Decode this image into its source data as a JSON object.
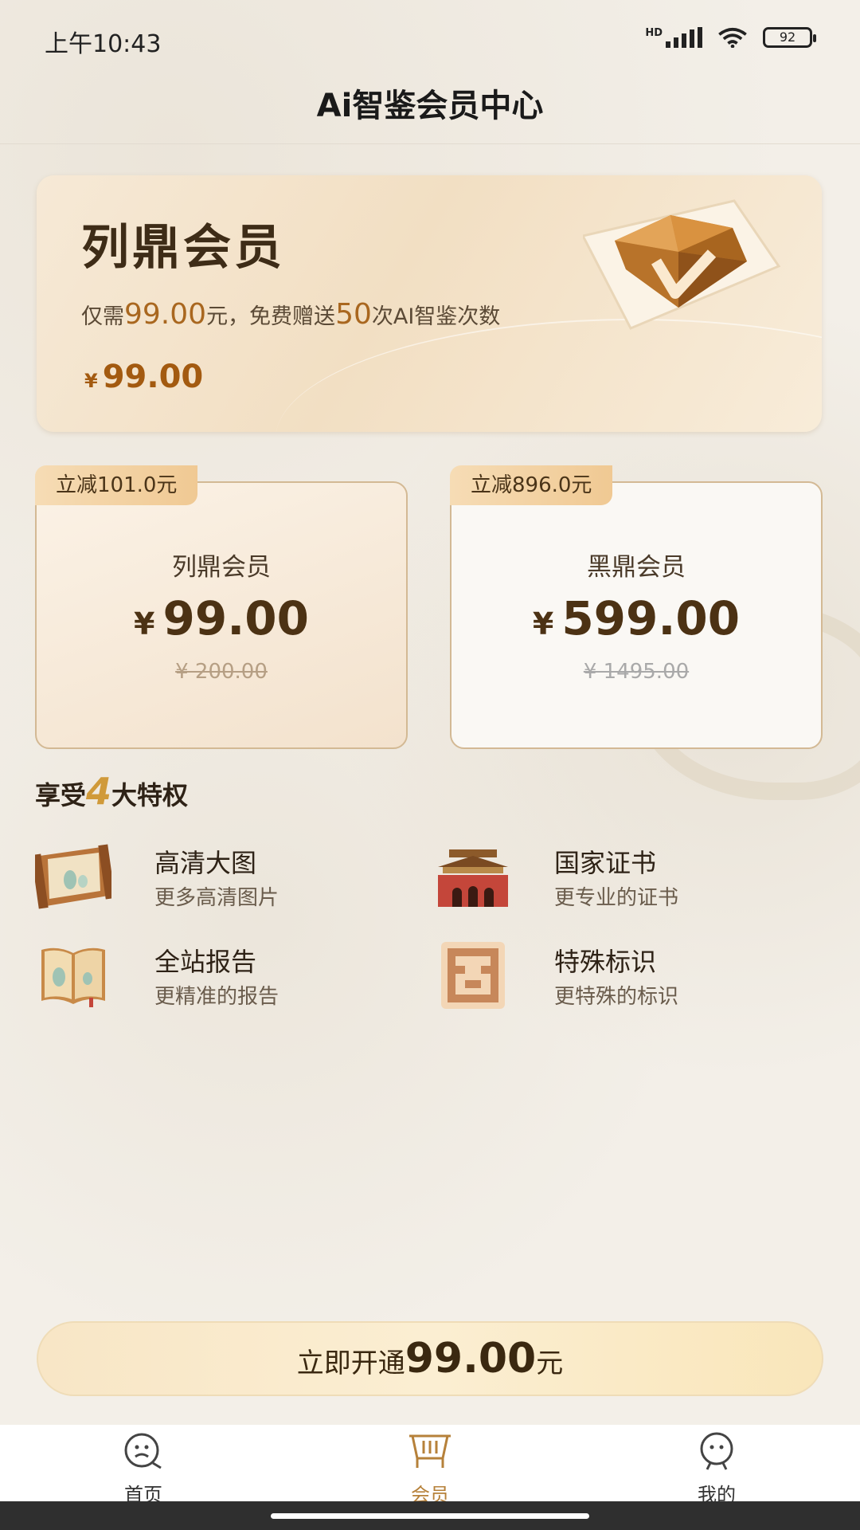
{
  "status_bar": {
    "time": "上午10:43",
    "battery": "92",
    "network": "HD"
  },
  "header": {
    "title": "Ai智鉴会员中心"
  },
  "hero": {
    "title": "列鼎会员",
    "desc_prefix": "仅需",
    "desc_price": "99.00",
    "desc_mid": "元，免费赠送",
    "desc_count": "50",
    "desc_suffix": "次AI智鉴次数",
    "currency": "¥",
    "price": "99.00"
  },
  "plans": [
    {
      "tag": "立减101.0元",
      "name": "列鼎会员",
      "currency": "¥",
      "price": "99.00",
      "original": "¥ 200.00",
      "selected": true
    },
    {
      "tag": "立减896.0元",
      "name": "黑鼎会员",
      "currency": "¥",
      "price": "599.00",
      "original": "¥ 1495.00",
      "selected": false
    }
  ],
  "privileges": {
    "head_pre": "享受",
    "head_num": "4",
    "head_post": "大特权",
    "items": [
      {
        "title": "高清大图",
        "subtitle": "更多高清图片",
        "icon": "scroll-painting-icon"
      },
      {
        "title": "国家证书",
        "subtitle": "更专业的证书",
        "icon": "palace-gate-icon"
      },
      {
        "title": "全站报告",
        "subtitle": "更精准的报告",
        "icon": "open-book-icon"
      },
      {
        "title": "特殊标识",
        "subtitle": "更特殊的标识",
        "icon": "seal-mark-icon"
      }
    ]
  },
  "cta": {
    "prefix": "立即开通",
    "amount": "99.00",
    "suffix": "元"
  },
  "tabbar": {
    "items": [
      {
        "label": "首页",
        "icon": "home-face-icon"
      },
      {
        "label": "会员",
        "icon": "member-cart-icon",
        "active": true
      },
      {
        "label": "我的",
        "icon": "profile-icon"
      }
    ]
  },
  "colors": {
    "accent": "#b6813a",
    "price": "#a35a10",
    "card_border": "#d3b994"
  }
}
